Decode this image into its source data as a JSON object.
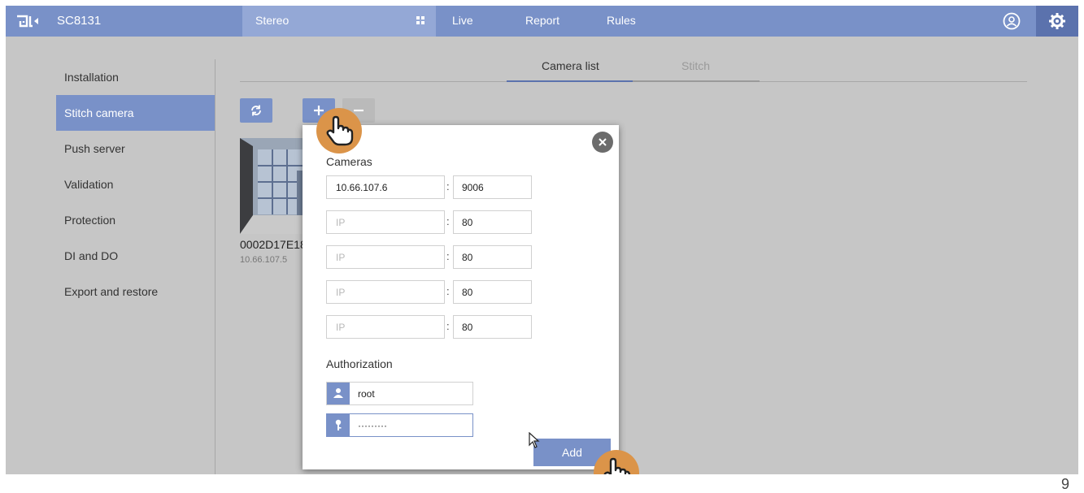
{
  "header": {
    "logo": "vivotek-logo",
    "model": "SC8131",
    "mode_label": "Stereo",
    "mode_icon": "grid-icon",
    "nav": [
      "Live",
      "Report",
      "Rules"
    ],
    "user_icon": "user-circle-icon",
    "settings_icon": "gear-icon",
    "accent": "#7991c8"
  },
  "sidebar": {
    "items": [
      {
        "label": "Installation"
      },
      {
        "label": "Stitch camera",
        "active": true
      },
      {
        "label": "Push server"
      },
      {
        "label": "Validation"
      },
      {
        "label": "Protection"
      },
      {
        "label": "DI and DO"
      },
      {
        "label": "Export and restore"
      }
    ]
  },
  "tabs": [
    {
      "label": "Camera list",
      "active": true
    },
    {
      "label": "Stitch"
    }
  ],
  "toolbar": {
    "refresh_icon": "refresh-icon",
    "add_icon": "plus-icon",
    "remove_icon": "minus-icon"
  },
  "camera_card": {
    "name": "0002D17E18",
    "ip": "10.66.107.5"
  },
  "dialog": {
    "cameras_title": "Cameras",
    "rows": [
      {
        "ip": "10.66.107.6",
        "ip_placeholder": "IP",
        "port": "9006"
      },
      {
        "ip": "",
        "ip_placeholder": "IP",
        "port": "80"
      },
      {
        "ip": "",
        "ip_placeholder": "IP",
        "port": "80"
      },
      {
        "ip": "",
        "ip_placeholder": "IP",
        "port": "80"
      },
      {
        "ip": "",
        "ip_placeholder": "IP",
        "port": "80"
      }
    ],
    "separator": ":",
    "auth_title": "Authorization",
    "username": "root",
    "password_mask": "·········",
    "add_label": "Add",
    "close_icon": "close-icon"
  },
  "page_number": "9"
}
